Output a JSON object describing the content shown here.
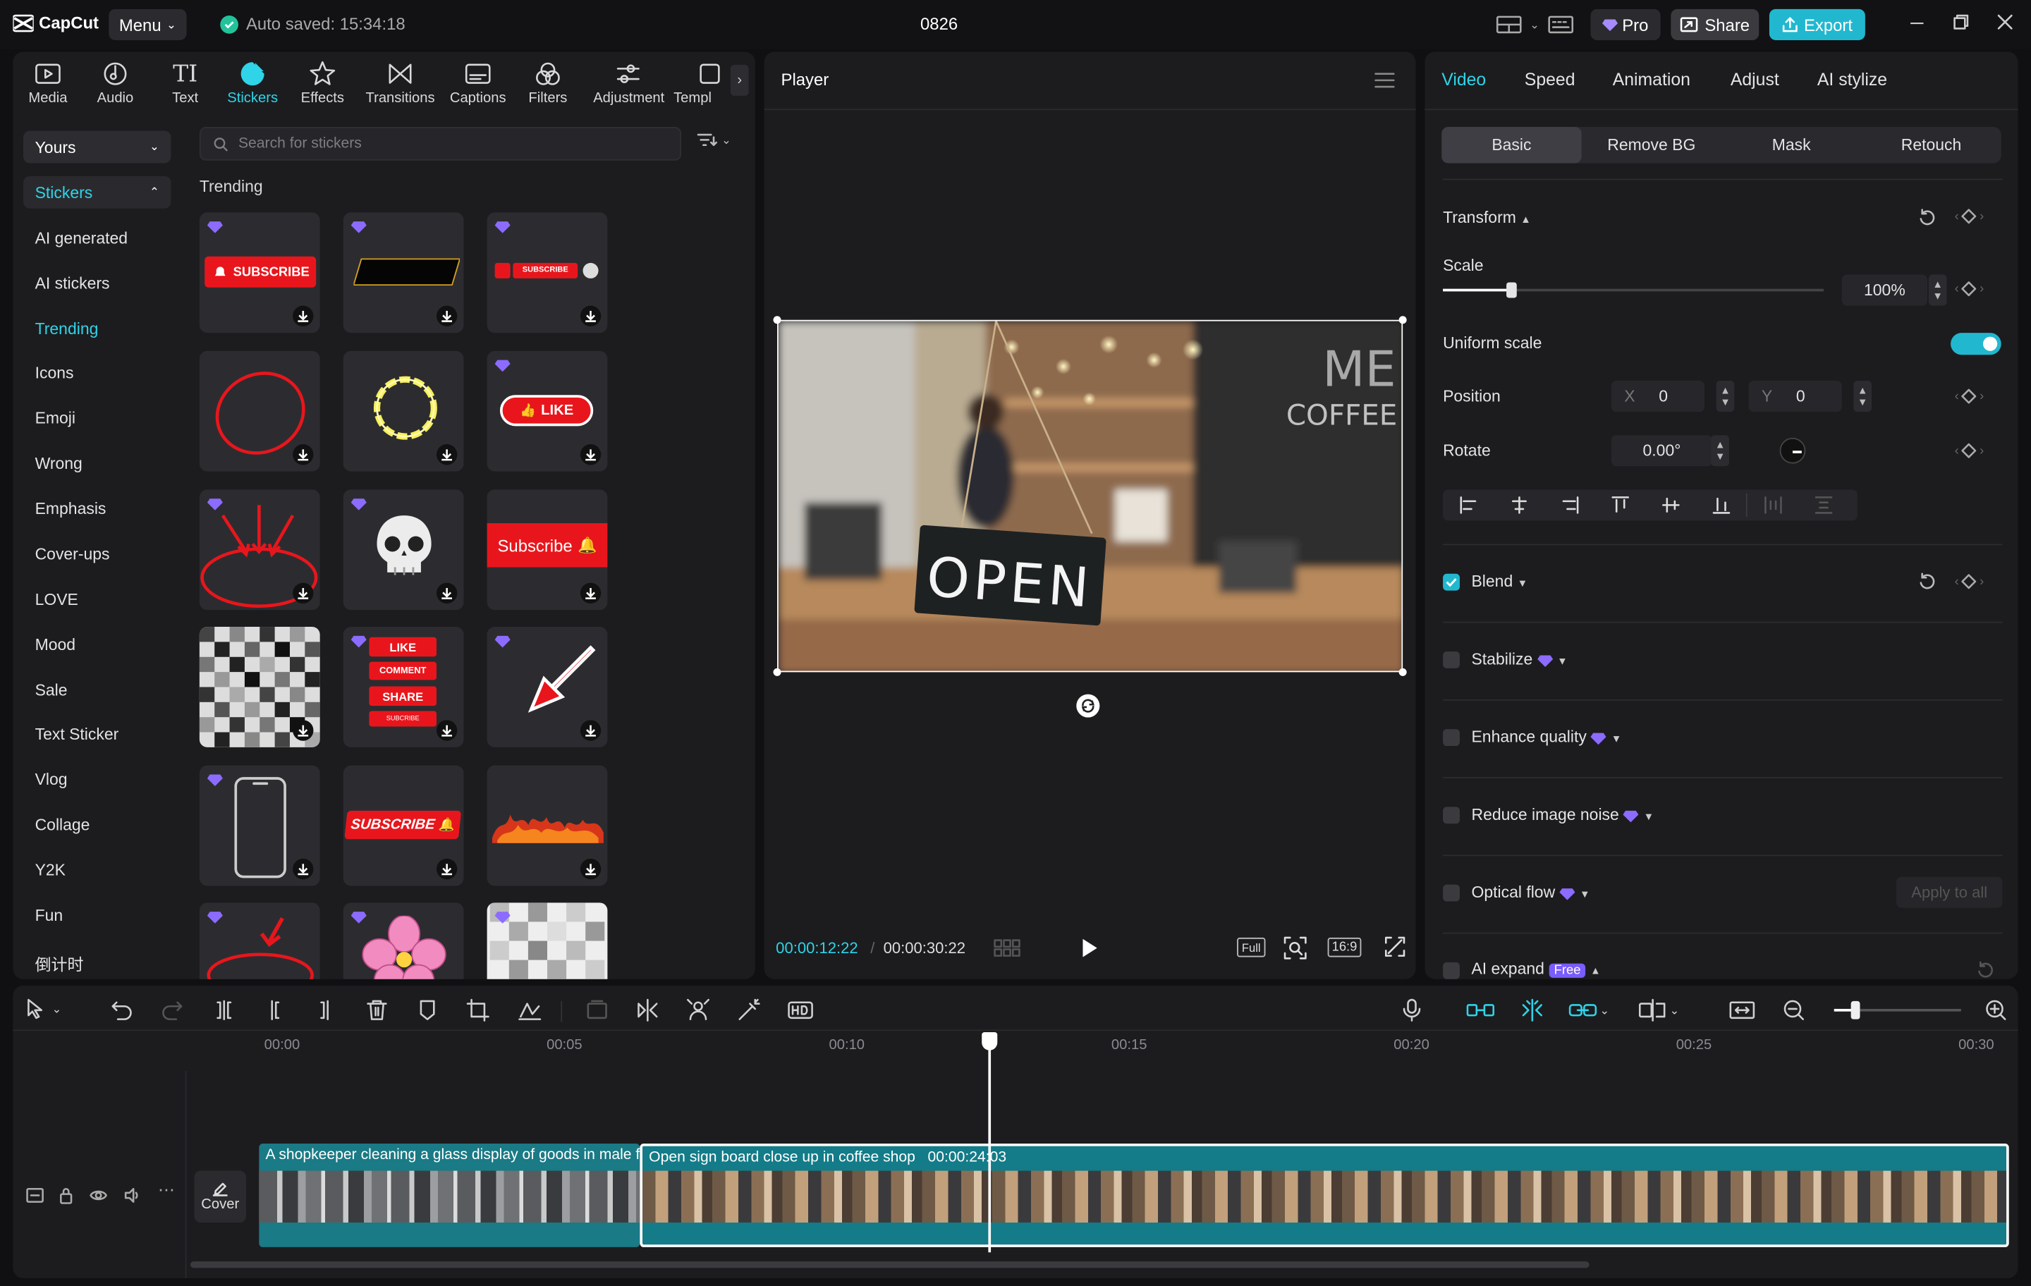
{
  "app": {
    "name": "CapCut",
    "menu_label": "Menu",
    "autosave": "Auto saved: 15:34:18",
    "project_title": "0826",
    "pro_label": "Pro",
    "share_label": "Share",
    "export_label": "Export"
  },
  "toolbar": {
    "tabs": [
      {
        "label": "Media"
      },
      {
        "label": "Audio"
      },
      {
        "label": "Text"
      },
      {
        "label": "Stickers"
      },
      {
        "label": "Effects"
      },
      {
        "label": "Transitions"
      },
      {
        "label": "Captions"
      },
      {
        "label": "Filters"
      },
      {
        "label": "Adjustment"
      },
      {
        "label": "Templ"
      }
    ],
    "active": "Stickers"
  },
  "sidebar": {
    "yours": "Yours",
    "stickers": "Stickers",
    "categories": [
      "AI generated",
      "AI stickers",
      "Trending",
      "Icons",
      "Emoji",
      "Wrong",
      "Emphasis",
      "Cover-ups",
      "LOVE",
      "Mood",
      "Sale",
      "Text Sticker",
      "Vlog",
      "Collage",
      "Y2K",
      "Fun",
      "倒计时"
    ],
    "active": "Trending"
  },
  "search": {
    "placeholder": "Search for stickers"
  },
  "stickers": {
    "section": "Trending",
    "texts": {
      "subscribe": "SUBSCRIBE",
      "subscribe_small": "SUBSCRIBE",
      "like": "LIKE",
      "subscribe_btn": "Subscribe",
      "like2": "LIKE",
      "comment": "COMMENT",
      "share": "SHARE",
      "subscribe_tiny": "SUBCRIBE",
      "subscribe_bold": "SUBSCRIBE"
    }
  },
  "player": {
    "title": "Player",
    "current_time": "00:00:12:22",
    "total_time": "00:00:30:22",
    "full_label": "Full",
    "ratio_label": "16:9",
    "sign_text": "OPEN",
    "board_text": "COFFEE"
  },
  "inspector": {
    "tabs": [
      "Video",
      "Speed",
      "Animation",
      "Adjust",
      "AI stylize"
    ],
    "active_tab": "Video",
    "subtabs": [
      "Basic",
      "Remove BG",
      "Mask",
      "Retouch"
    ],
    "active_subtab": "Basic",
    "transform": "Transform",
    "scale_label": "Scale",
    "scale_value": "100%",
    "scale_fraction": 0.18,
    "uniform_scale": "Uniform scale",
    "uniform_on": true,
    "position_label": "Position",
    "pos_x_label": "X",
    "pos_x": "0",
    "pos_y_label": "Y",
    "pos_y": "0",
    "rotate_label": "Rotate",
    "rotate_value": "0.00°",
    "blend": "Blend",
    "blend_on": true,
    "stabilize": "Stabilize",
    "enhance": "Enhance quality",
    "noise": "Reduce image noise",
    "optical": "Optical flow",
    "apply_all": "Apply to all",
    "ai_expand": "AI expand",
    "free_badge": "Free"
  },
  "timeline": {
    "ruler": [
      "00:00",
      "00:05",
      "00:10",
      "00:15",
      "00:20",
      "00:25",
      "00:30"
    ],
    "cover_label": "Cover",
    "clip1_label": "A shopkeeper cleaning a glass display of goods in male fa",
    "clip2_label": "Open sign board close up in coffee shop",
    "clip2_duration": "00:00:24:03"
  },
  "colors": {
    "accent": "#2fd4e8",
    "export": "#21b8cf",
    "clip": "#137c88",
    "sticker_red": "#e8161c"
  }
}
